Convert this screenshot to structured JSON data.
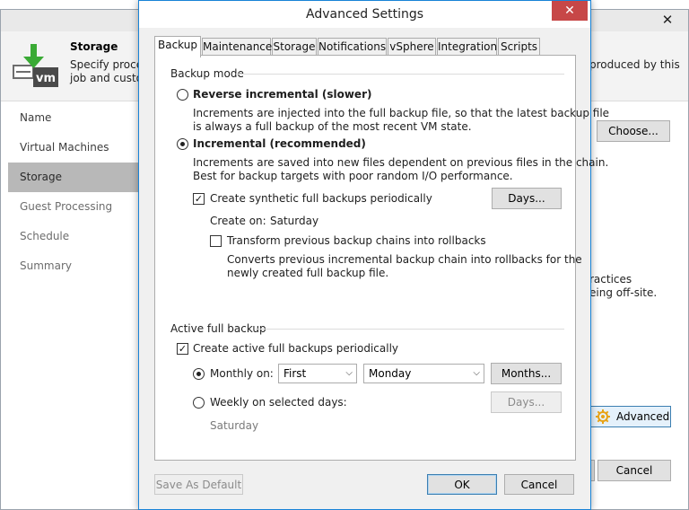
{
  "background_window": {
    "header_title": "Storage",
    "header_desc_line1": "Specify proces",
    "header_desc_line2": "job and custon",
    "header_desc_right": "produced by this",
    "nav": [
      "Name",
      "Virtual Machines",
      "Storage",
      "Guest Processing",
      "Schedule",
      "Summary"
    ],
    "nav_active": "Storage",
    "choose_button": "Choose...",
    "practices_line1": "ractices",
    "practices_line2": "eing off-site.",
    "advanced_button": "Advanced",
    "cancel_button": "Cancel",
    "close_glyph": "✕"
  },
  "dialog": {
    "title": "Advanced Settings",
    "close_glyph": "✕",
    "tabs": [
      "Backup",
      "Maintenance",
      "Storage",
      "Notifications",
      "vSphere",
      "Integration",
      "Scripts"
    ],
    "active_tab": "Backup",
    "backup_mode": {
      "heading": "Backup mode",
      "reverse_label": "Reverse incremental (slower)",
      "reverse_desc_line1": "Increments are injected into the full backup file, so that the latest backup file",
      "reverse_desc_line2": "is always a full backup of the most recent VM state.",
      "incremental_label": "Incremental (recommended)",
      "incremental_desc_line1": "Increments are saved into new files dependent on previous files in the chain.",
      "incremental_desc_line2": "Best for backup targets with poor random I/O performance.",
      "selected": "incremental",
      "synthetic_label": "Create synthetic full backups periodically",
      "synthetic_checked": true,
      "days_button": "Days...",
      "create_on_label": "Create on:",
      "create_on_value": "Saturday",
      "transform_label": "Transform previous backup chains into rollbacks",
      "transform_checked": false,
      "transform_desc_line1": "Converts previous incremental backup chain into rollbacks for the",
      "transform_desc_line2": "newly created full backup file."
    },
    "active_full": {
      "heading": "Active full backup",
      "periodic_label": "Create active full backups periodically",
      "periodic_checked": true,
      "monthly_label": "Monthly on:",
      "monthly_selected": true,
      "monthly_week": "First",
      "monthly_day": "Monday",
      "months_button": "Months...",
      "weekly_label": "Weekly on selected days:",
      "weekly_days_button": "Days...",
      "weekly_value": "Saturday"
    },
    "footer": {
      "save_default": "Save As Default",
      "ok": "OK",
      "cancel": "Cancel"
    }
  }
}
